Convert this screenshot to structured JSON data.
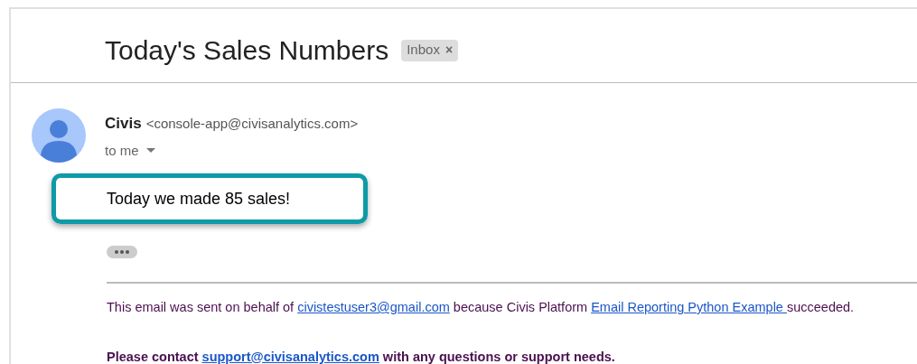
{
  "subject": "Today's Sales Numbers",
  "label": {
    "text": "Inbox",
    "close": "×"
  },
  "sender": {
    "name": "Civis",
    "email": "<console-app@civisanalytics.com>",
    "recipient": "to me"
  },
  "body": "Today we made 85 sales!",
  "footer": [
    {
      "bold": false,
      "parts": [
        {
          "kind": "text",
          "text": "This email was sent on behalf of "
        },
        {
          "kind": "link",
          "text": "civistestuser3@gmail.com"
        },
        {
          "kind": "text",
          "text": " because Civis Platform "
        },
        {
          "kind": "link",
          "text": "Email Reporting Python Example "
        },
        {
          "kind": "text",
          "text": "succeeded."
        }
      ]
    },
    {
      "bold": true,
      "parts": [
        {
          "kind": "text",
          "text": "Please contact "
        },
        {
          "kind": "link",
          "text": "support@civisanalytics.com"
        },
        {
          "kind": "text",
          "text": " with any questions or support needs."
        }
      ]
    }
  ]
}
